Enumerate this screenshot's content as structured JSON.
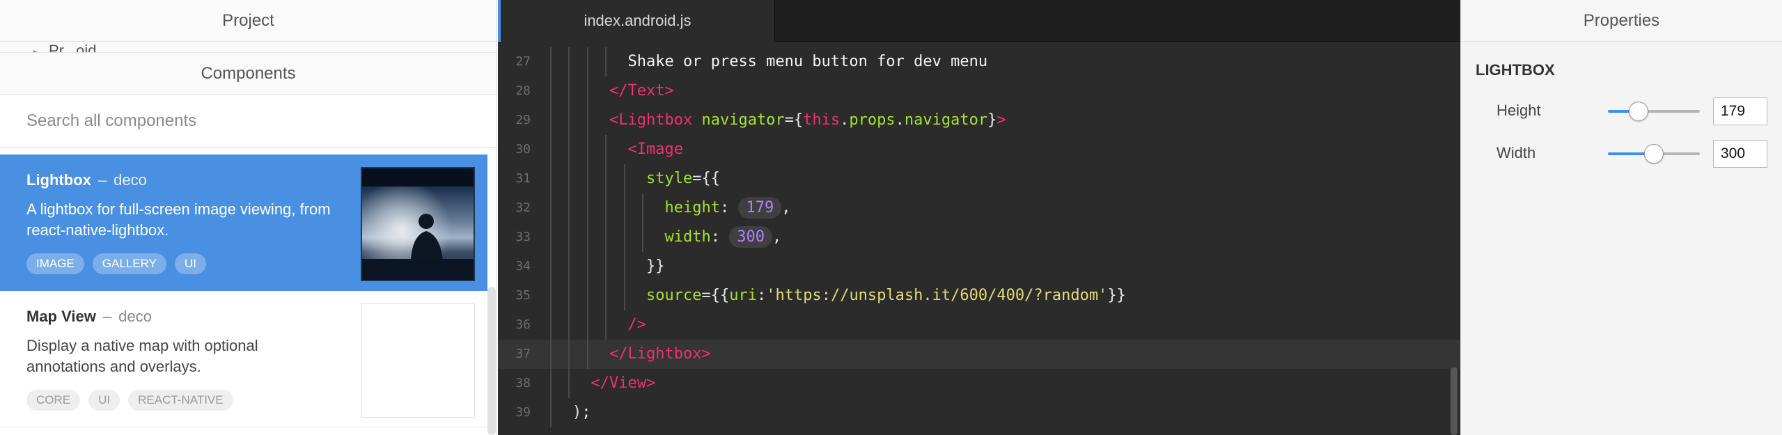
{
  "left_panel": {
    "project_title": "Project",
    "project_peek_text": "Pr...oid",
    "components_title": "Components",
    "search_placeholder": "Search all components",
    "components": [
      {
        "name": "Lightbox",
        "separator": "–",
        "vendor": "deco",
        "description": "A lightbox for full-screen image viewing, from react-native-lightbox.",
        "tags": [
          "IMAGE",
          "GALLERY",
          "UI"
        ],
        "selected": true,
        "thumbnail": "person-silhouette-sunset-image"
      },
      {
        "name": "Map View",
        "separator": "–",
        "vendor": "deco",
        "description": "Display a native map with optional annotations and overlays.",
        "tags": [
          "CORE",
          "UI",
          "REACT-NATIVE"
        ],
        "selected": false,
        "thumbnail": ""
      }
    ]
  },
  "editor": {
    "tab_label": "index.android.js",
    "current_line": 37,
    "lines": [
      {
        "n": "27",
        "indent": 5,
        "tokens": [
          {
            "c": "t-text",
            "v": "Shake or press menu button for dev menu"
          }
        ]
      },
      {
        "n": "28",
        "indent": 4,
        "tokens": [
          {
            "c": "t-tag",
            "v": "</Text>"
          }
        ]
      },
      {
        "n": "29",
        "indent": 4,
        "tokens": [
          {
            "c": "t-tag",
            "v": "<Lightbox"
          },
          {
            "c": "t-pun",
            "v": " "
          },
          {
            "c": "t-attr",
            "v": "navigator"
          },
          {
            "c": "t-pun",
            "v": "={"
          },
          {
            "c": "t-this",
            "v": "this"
          },
          {
            "c": "t-pun",
            "v": "."
          },
          {
            "c": "t-prop",
            "v": "props"
          },
          {
            "c": "t-pun",
            "v": "."
          },
          {
            "c": "t-prop",
            "v": "navigator"
          },
          {
            "c": "t-pun",
            "v": "}"
          },
          {
            "c": "t-tag",
            "v": ">"
          }
        ]
      },
      {
        "n": "30",
        "indent": 5,
        "tokens": [
          {
            "c": "t-tag",
            "v": "<Image"
          }
        ]
      },
      {
        "n": "31",
        "indent": 6,
        "tokens": [
          {
            "c": "t-attr",
            "v": "style"
          },
          {
            "c": "t-pun",
            "v": "={{"
          }
        ]
      },
      {
        "n": "32",
        "indent": 7,
        "tokens": [
          {
            "c": "t-attr",
            "v": "height"
          },
          {
            "c": "t-pun",
            "v": ": "
          },
          {
            "c": "t-num",
            "v": "179"
          },
          {
            "c": "t-pun",
            "v": ","
          }
        ]
      },
      {
        "n": "33",
        "indent": 7,
        "tokens": [
          {
            "c": "t-attr",
            "v": "width"
          },
          {
            "c": "t-pun",
            "v": ": "
          },
          {
            "c": "t-num",
            "v": "300"
          },
          {
            "c": "t-pun",
            "v": ","
          }
        ]
      },
      {
        "n": "34",
        "indent": 6,
        "tokens": [
          {
            "c": "t-pun",
            "v": "}}"
          }
        ]
      },
      {
        "n": "35",
        "indent": 6,
        "tokens": [
          {
            "c": "t-attr",
            "v": "source"
          },
          {
            "c": "t-pun",
            "v": "={{"
          },
          {
            "c": "t-attr",
            "v": "uri"
          },
          {
            "c": "t-pun",
            "v": ":"
          },
          {
            "c": "t-str",
            "v": "'https://unsplash.it/600/400/?random'"
          },
          {
            "c": "t-pun",
            "v": "}}"
          }
        ]
      },
      {
        "n": "36",
        "indent": 5,
        "tokens": [
          {
            "c": "t-tag",
            "v": "/>"
          }
        ]
      },
      {
        "n": "37",
        "indent": 4,
        "tokens": [
          {
            "c": "t-tag",
            "v": "</Lightbox>"
          }
        ]
      },
      {
        "n": "38",
        "indent": 3,
        "tokens": [
          {
            "c": "t-tag",
            "v": "</View>"
          }
        ]
      },
      {
        "n": "39",
        "indent": 2,
        "tokens": [
          {
            "c": "t-pun",
            "v": ");"
          }
        ]
      }
    ]
  },
  "properties_panel": {
    "title": "Properties",
    "section": "LIGHTBOX",
    "props": [
      {
        "label": "Height",
        "value": "179",
        "slider_fraction": 0.33
      },
      {
        "label": "Width",
        "value": "300",
        "slider_fraction": 0.5
      }
    ]
  },
  "colors": {
    "accent": "#4a90e2",
    "editor_bg": "#2b2b2b",
    "jsx_tag": "#f0306f",
    "jsx_attr": "#a6e22e",
    "string": "#e6db74",
    "number": "#ae81ff"
  }
}
